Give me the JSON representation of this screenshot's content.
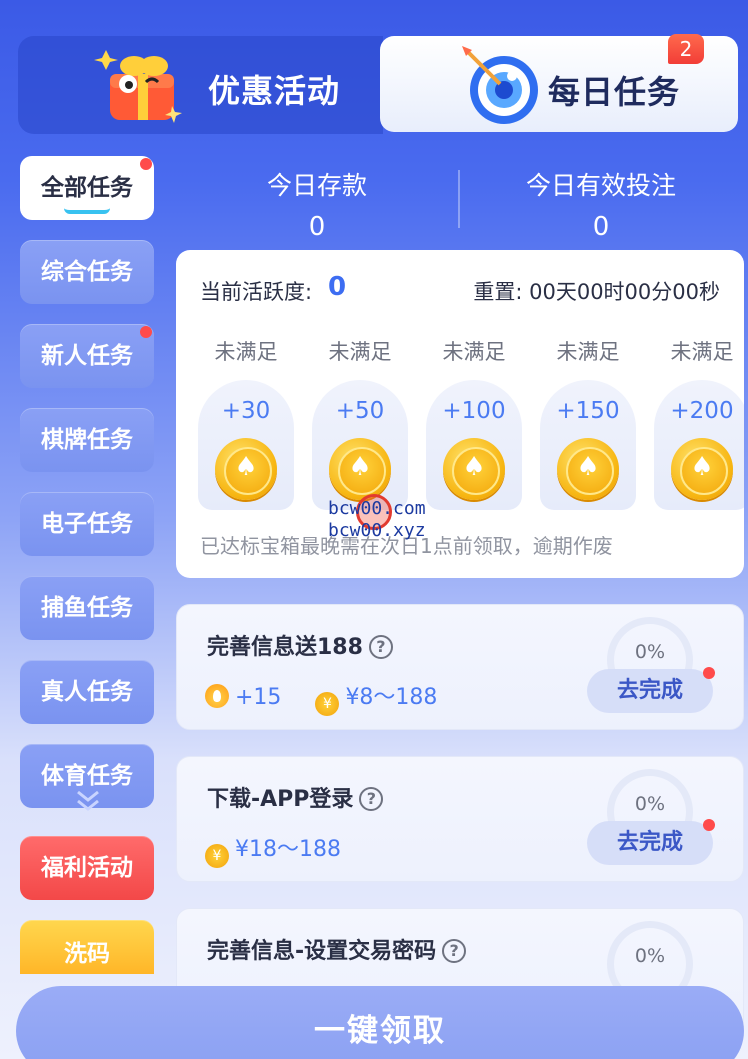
{
  "tabs": {
    "promo": "优惠活动",
    "daily": "每日任务",
    "daily_badge": "2"
  },
  "sidebar": {
    "items": [
      {
        "label": "全部任务",
        "active": true,
        "dot": true
      },
      {
        "label": "综合任务"
      },
      {
        "label": "新人任务",
        "dot": true
      },
      {
        "label": "棋牌任务"
      },
      {
        "label": "电子任务"
      },
      {
        "label": "捕鱼任务"
      },
      {
        "label": "真人任务"
      },
      {
        "label": "体育任务"
      },
      {
        "label": "福利活动"
      },
      {
        "label": "洗码"
      }
    ]
  },
  "stats": {
    "deposit_label": "今日存款",
    "deposit_value": "0",
    "bet_label": "今日有效投注",
    "bet_value": "0"
  },
  "activity": {
    "label": "当前活跃度:",
    "value": "0",
    "reset": "重置: 00天00时00分00秒",
    "rewards": [
      {
        "status": "未满足",
        "points": "+30"
      },
      {
        "status": "未满足",
        "points": "+50"
      },
      {
        "status": "未满足",
        "points": "+100"
      },
      {
        "status": "未满足",
        "points": "+150"
      },
      {
        "status": "未满足",
        "points": "+200"
      }
    ],
    "note": "已达标宝箱最晚需在次日1点前领取，逾期作废"
  },
  "watermark": {
    "line1": "bcw00.com",
    "line2": "bcw00.xyz"
  },
  "tasks": [
    {
      "title": "完善信息送188",
      "activity": "+15",
      "money": "¥8～188",
      "progress": "0%",
      "action": "去完成"
    },
    {
      "title": "下载-APP登录",
      "money": "¥18～188",
      "progress": "0%",
      "action": "去完成"
    },
    {
      "title": "完善信息-设置交易密码",
      "progress": "0%"
    }
  ],
  "claim_all": "一键领取",
  "icons": {
    "money_glyph": "¥",
    "help_glyph": "?",
    "spade_glyph": "♠"
  }
}
